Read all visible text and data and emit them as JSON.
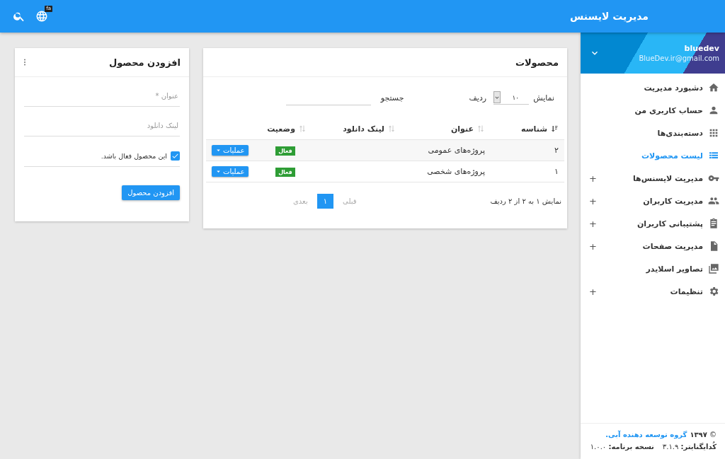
{
  "header": {
    "title": "مدیریت لایسنس",
    "language_badge": "fa"
  },
  "user": {
    "name": "bluedev",
    "email": "BlueDev.ir@gmail.com"
  },
  "sidebar": {
    "items": [
      {
        "label": "دشبورد مدیریت",
        "selected": false
      },
      {
        "label": "حساب کاربری من",
        "selected": false
      },
      {
        "label": "دسته‌بندی‌ها",
        "selected": false
      },
      {
        "label": "لیست محصولات",
        "selected": true
      },
      {
        "label": "مدیریت لایسنس‌ها",
        "selected": false,
        "toggle": "+"
      },
      {
        "label": "مدیریت کاربران",
        "selected": false,
        "toggle": "+"
      },
      {
        "label": "پشتیبانی کاربران",
        "selected": false,
        "toggle": "+"
      },
      {
        "label": "مدیریت صفحات",
        "selected": false,
        "toggle": "+"
      },
      {
        "label": "تصاویر اسلایدر",
        "selected": false
      },
      {
        "label": "تنظیمات",
        "selected": false,
        "toggle": "+"
      }
    ]
  },
  "footer": {
    "copyright": "© **۱۳۹۷**",
    "link": "گروه توسعه دهنده آبی.",
    "framework": "**کُدایگنایتر:** ۳.۱.۹",
    "version": "**نسخه برنامه:** ۱.۰.۰"
  },
  "products": {
    "title": "محصولات",
    "show_label": "نمایش",
    "page_size": "۱۰",
    "rows_label": "ردیف",
    "search_label": "جستجو",
    "columns": [
      "شناسه",
      "عنوان",
      "لینک دانلود",
      "وضعیت"
    ],
    "rows": [
      {
        "id": "۲",
        "title": "پروژه‌های عمومی",
        "status": "فعال",
        "action": "عملیات"
      },
      {
        "id": "۱",
        "title": "پروژه‌های شخصی",
        "status": "فعال",
        "action": "عملیات"
      }
    ],
    "info": "نمایش ۱ به ۲ از ۲ ردیف",
    "pagination": [
      {
        "label": "قبلی",
        "disabled": true,
        "selected": false
      },
      {
        "label": "۱",
        "selected": true
      },
      {
        "label": "بعدی",
        "disabled": true,
        "selected": false
      }
    ]
  },
  "add_product": {
    "title": "افزودن محصول",
    "fields": [
      {
        "placeholder": "عنوان *"
      },
      {
        "placeholder": "لینک دانلود"
      }
    ],
    "active_checkbox": {
      "label": "این محصول فعال باشد.",
      "checked": true
    },
    "submit": "افزودن محصول"
  }
}
